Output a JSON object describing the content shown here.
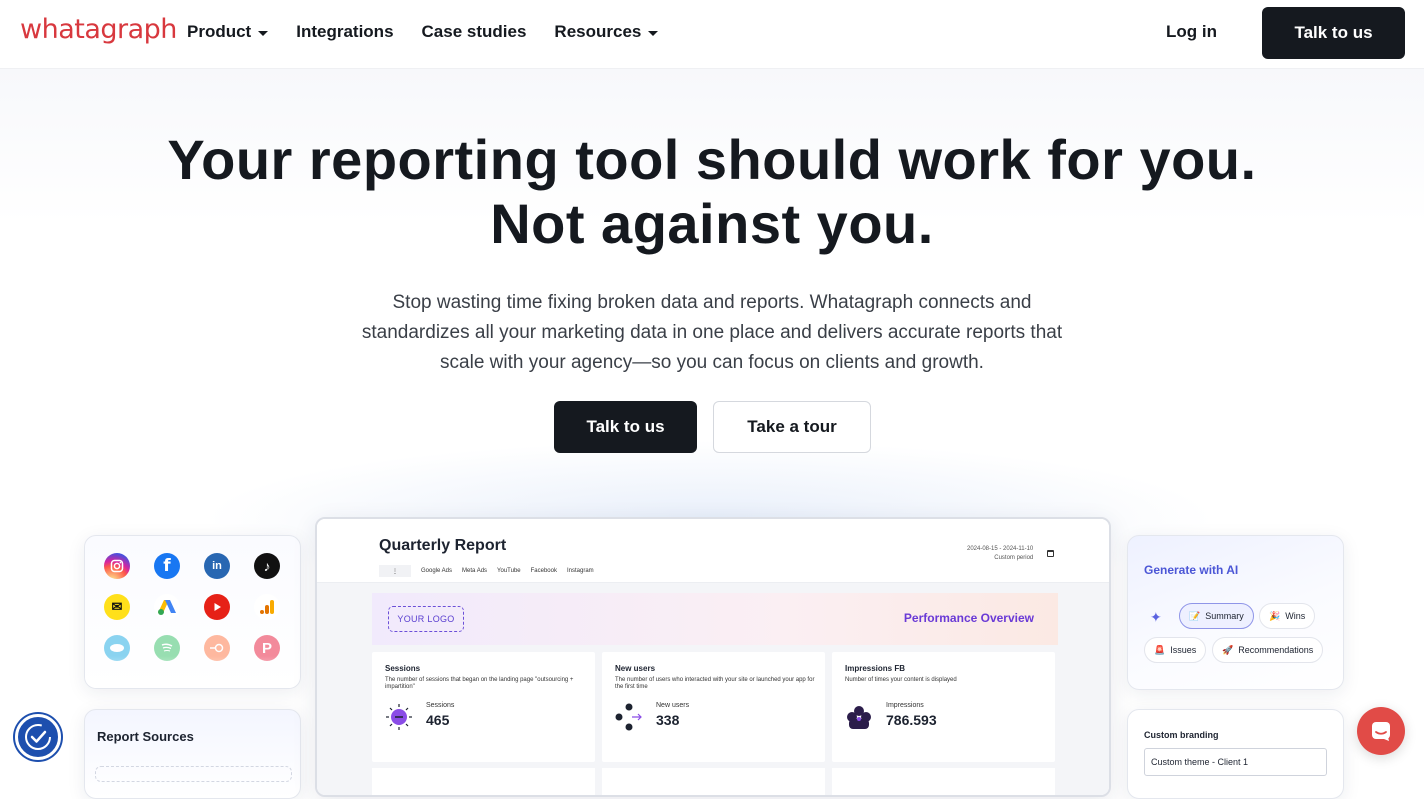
{
  "nav": {
    "logo": "whatagraph",
    "links": [
      {
        "label": "Product",
        "dropdown": true
      },
      {
        "label": "Integrations",
        "dropdown": false
      },
      {
        "label": "Case studies",
        "dropdown": false
      },
      {
        "label": "Resources",
        "dropdown": true
      }
    ],
    "login": "Log in",
    "cta": "Talk to us"
  },
  "hero": {
    "headline_line1": "Your reporting tool should work for you.",
    "headline_line2": "Not against you.",
    "subtext": "Stop wasting time fixing broken data and reports. Whatagraph connects and standardizes all your marketing data in one place and delivers accurate reports that scale with your agency—so you can focus on clients and growth.",
    "primary_button": "Talk to us",
    "secondary_button": "Take a tour"
  },
  "integrations_card": {
    "icons": [
      "instagram-icon",
      "facebook-icon",
      "linkedin-icon",
      "tiktok-icon",
      "mailchimp-icon",
      "google-ads-icon",
      "youtube-icon",
      "google-analytics-icon",
      "salesforce-icon",
      "spotify-icon",
      "semrush-icon",
      "pinterest-icon"
    ]
  },
  "report_sources": {
    "title": "Report Sources"
  },
  "report": {
    "title": "Quarterly Report",
    "date_range": "2024-08-15 - 2024-11-10",
    "period_label": "Custom period",
    "tabs": [
      "⋮",
      "Google Ads",
      "Meta Ads",
      "YouTube",
      "Facebook",
      "Instagram"
    ],
    "logo_placeholder": "YOUR LOGO",
    "banner_title": "Performance Overview",
    "metrics": [
      {
        "name": "Sessions",
        "desc": "The number of sessions that began on the landing page \"outsourcing + impartition\"",
        "label": "Sessions",
        "value": "465"
      },
      {
        "name": "New users",
        "desc": "The number of users who interacted with your site or launched your app for the first time",
        "label": "New users",
        "value": "338"
      },
      {
        "name": "Impressions FB",
        "desc": "Number of times your content is displayed",
        "label": "Impressions",
        "value": "786.593"
      }
    ]
  },
  "ai_card": {
    "title": "Generate with AI",
    "chips": [
      {
        "emoji": "📝",
        "label": "Summary",
        "selected": true
      },
      {
        "emoji": "🎉",
        "label": "Wins",
        "selected": false
      },
      {
        "emoji": "🚨",
        "label": "Issues",
        "selected": false
      },
      {
        "emoji": "🚀",
        "label": "Recommendations",
        "selected": false
      }
    ]
  },
  "branding_card": {
    "title": "Custom branding",
    "input_value": "Custom theme - Client 1"
  },
  "colors": {
    "brand_red": "#d8383e",
    "dark": "#15191f",
    "accent_purple": "#6a3ad6",
    "ai_blue": "#4b56d6",
    "accessibility_blue": "#1d4fae",
    "chat_red": "#e14b47"
  }
}
